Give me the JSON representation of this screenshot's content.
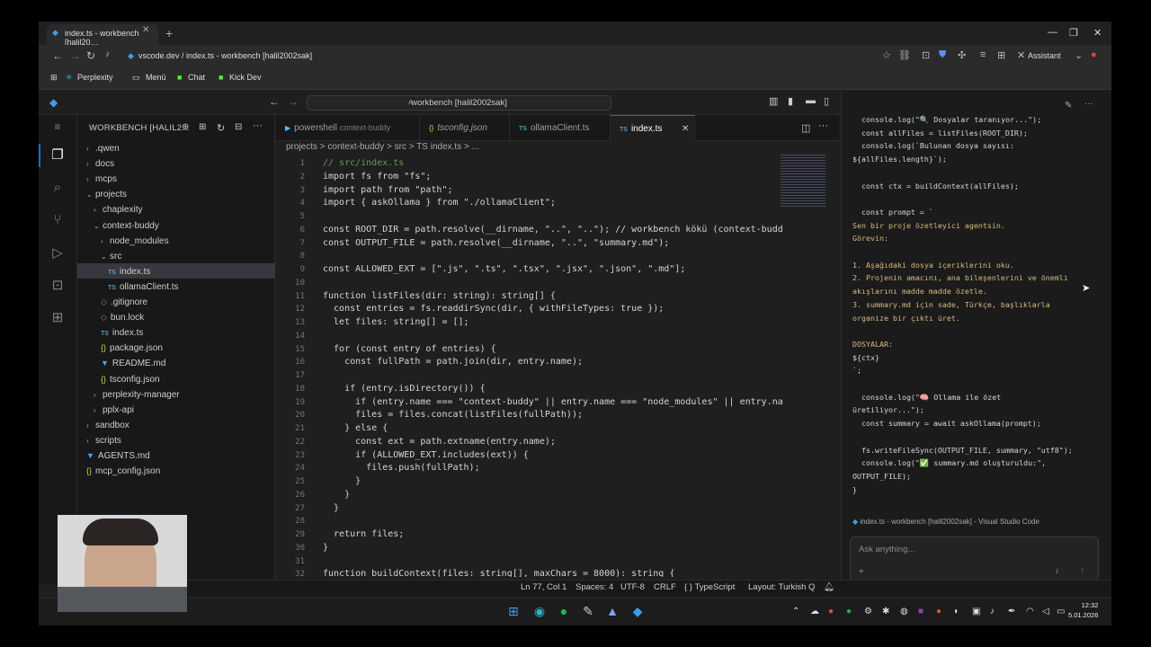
{
  "browser": {
    "tab_title": "index.ts - workbench [halil20…",
    "url": "vscode.dev / index.ts - workbench [halil2002sak]",
    "assistant_label": "Assistant",
    "bookmarks": [
      "Perplexity",
      "Menü",
      "Chat",
      "Kick Dev"
    ]
  },
  "vscode": {
    "command_center": "workbench [halil2002sak]",
    "explorer_title": "WORKBENCH [HALIL2...",
    "tree": [
      {
        "label": ".qwen",
        "type": "folder"
      },
      {
        "label": "docs",
        "type": "folder"
      },
      {
        "label": "mcps",
        "type": "folder"
      },
      {
        "label": "projects",
        "type": "folder-open"
      },
      {
        "label": "chaplexity",
        "type": "folder"
      },
      {
        "label": "context-buddy",
        "type": "folder-open"
      },
      {
        "label": "node_modules",
        "type": "folder"
      },
      {
        "label": "src",
        "type": "folder-open"
      },
      {
        "label": "index.ts",
        "type": "ts"
      },
      {
        "label": "ollamaClient.ts",
        "type": "ts"
      },
      {
        "label": ".gitignore",
        "type": "file"
      },
      {
        "label": "bun.lock",
        "type": "file"
      },
      {
        "label": "index.ts",
        "type": "ts"
      },
      {
        "label": "package.json",
        "type": "json"
      },
      {
        "label": "README.md",
        "type": "md"
      },
      {
        "label": "tsconfig.json",
        "type": "json"
      },
      {
        "label": "perplexity-manager",
        "type": "folder"
      },
      {
        "label": "pplx-api",
        "type": "folder"
      },
      {
        "label": "sandbox",
        "type": "folder"
      },
      {
        "label": "scripts",
        "type": "folder"
      },
      {
        "label": "AGENTS.md",
        "type": "md"
      },
      {
        "label": "mcp_config.json",
        "type": "json"
      }
    ],
    "tabs": [
      {
        "label": "powershell",
        "detail": "context-buddy"
      },
      {
        "label": "tsconfig.json",
        "detail": ""
      },
      {
        "label": "ollamaClient.ts",
        "detail": ""
      },
      {
        "label": "index.ts",
        "detail": ""
      }
    ],
    "breadcrumb": "projects > context-buddy > src > TS index.ts > ...",
    "code": [
      {
        "n": "1",
        "text": "// src/index.ts"
      },
      {
        "n": "2",
        "text": "import fs from \"fs\";"
      },
      {
        "n": "3",
        "text": "import path from \"path\";"
      },
      {
        "n": "4",
        "text": "import { askOllama } from \"./ollamaClient\";"
      },
      {
        "n": "5",
        "text": ""
      },
      {
        "n": "6",
        "text": "const ROOT_DIR = path.resolve(__dirname, \"..\", \"..\"); // workbench kökü (context-budd"
      },
      {
        "n": "7",
        "text": "const OUTPUT_FILE = path.resolve(__dirname, \"..\", \"summary.md\");"
      },
      {
        "n": "8",
        "text": ""
      },
      {
        "n": "9",
        "text": "const ALLOWED_EXT = [\".js\", \".ts\", \".tsx\", \".jsx\", \".json\", \".md\"];"
      },
      {
        "n": "10",
        "text": ""
      },
      {
        "n": "11",
        "text": "function listFiles(dir: string): string[] {"
      },
      {
        "n": "12",
        "text": "  const entries = fs.readdirSync(dir, { withFileTypes: true });"
      },
      {
        "n": "13",
        "text": "  let files: string[] = [];"
      },
      {
        "n": "14",
        "text": ""
      },
      {
        "n": "15",
        "text": "  for (const entry of entries) {"
      },
      {
        "n": "16",
        "text": "    const fullPath = path.join(dir, entry.name);"
      },
      {
        "n": "17",
        "text": ""
      },
      {
        "n": "18",
        "text": "    if (entry.isDirectory()) {"
      },
      {
        "n": "19",
        "text": "      if (entry.name === \"context-buddy\" || entry.name === \"node_modules\" || entry.na"
      },
      {
        "n": "20",
        "text": "      files = files.concat(listFiles(fullPath));"
      },
      {
        "n": "21",
        "text": "    } else {"
      },
      {
        "n": "22",
        "text": "      const ext = path.extname(entry.name);"
      },
      {
        "n": "23",
        "text": "      if (ALLOWED_EXT.includes(ext)) {"
      },
      {
        "n": "24",
        "text": "        files.push(fullPath);"
      },
      {
        "n": "25",
        "text": "      }"
      },
      {
        "n": "26",
        "text": "    }"
      },
      {
        "n": "27",
        "text": "  }"
      },
      {
        "n": "28",
        "text": ""
      },
      {
        "n": "29",
        "text": "  return files;"
      },
      {
        "n": "30",
        "text": "}"
      },
      {
        "n": "31",
        "text": ""
      },
      {
        "n": "32",
        "text": "function buildContext(files: string[], maxChars = 8000): string {"
      }
    ],
    "status": {
      "position": "Ln 77, Col 1",
      "spaces": "Spaces: 4",
      "encoding": "UTF-8",
      "eol": "CRLF",
      "language": "{ } TypeScript",
      "layout": "Layout: Turkish Q"
    }
  },
  "chat": {
    "lines": [
      {
        "t": "  console.log(\"🔍 Dosyalar taranıyor...\");",
        "y": false
      },
      {
        "t": "  const allFiles = listFiles(ROOT_DIR);",
        "y": false
      },
      {
        "t": "  console.log(`Bulunan dosya sayısı:",
        "y": false
      },
      {
        "t": "${allFiles.length}`);",
        "y": false
      },
      {
        "t": "",
        "y": false
      },
      {
        "t": "  const ctx = buildContext(allFiles);",
        "y": false
      },
      {
        "t": "",
        "y": false
      },
      {
        "t": "  const prompt = `",
        "y": false
      },
      {
        "t": "Sen bir proje özetleyici agentsin.",
        "y": true
      },
      {
        "t": "Görevin:",
        "y": true
      },
      {
        "t": "",
        "y": false
      },
      {
        "t": "1. Aşağıdaki dosya içeriklerini oku.",
        "y": true
      },
      {
        "t": "2. Projenin amacını, ana bileşenlerini ve önemli",
        "y": true
      },
      {
        "t": "akışlarını madde madde özetle.",
        "y": true
      },
      {
        "t": "3. summary.md için sade, Türkçe, başlıklarla",
        "y": true
      },
      {
        "t": "organize bir çıktı üret.",
        "y": true
      },
      {
        "t": "",
        "y": false
      },
      {
        "t": "DOSYALAR:",
        "y": true
      },
      {
        "t": "${ctx}",
        "y": false
      },
      {
        "t": "`;",
        "y": false
      },
      {
        "t": "",
        "y": false
      },
      {
        "t": "  console.log(\"🧠 Ollama ile özet",
        "y": false
      },
      {
        "t": "üretiliyor...\");",
        "y": false
      },
      {
        "t": "  const summary = await askOllama(prompt);",
        "y": false
      },
      {
        "t": "",
        "y": false
      },
      {
        "t": "  fs.writeFileSync(OUTPUT_FILE, summary, \"utf8\");",
        "y": false
      },
      {
        "t": "  console.log(\"✅ summary.md oluşturuldu:\",",
        "y": false
      },
      {
        "t": "OUTPUT_FILE);",
        "y": false
      },
      {
        "t": "}",
        "y": false
      }
    ],
    "context_ref": "index.ts - workbench [halil2002sak] - Visual Studio Code",
    "input_placeholder": "Ask anything..."
  },
  "taskbar": {
    "time": "12:32",
    "date": "5.01.2026"
  }
}
